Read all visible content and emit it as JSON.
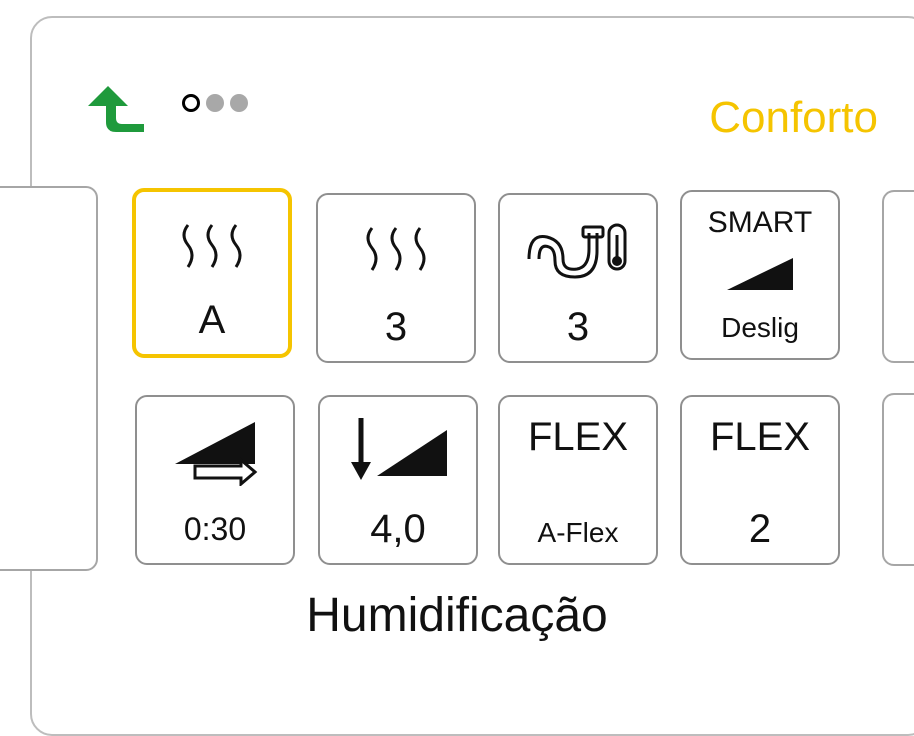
{
  "header": {
    "title": "Conforto",
    "back_icon": "back-arrow-icon",
    "page_dots": [
      "active",
      "inactive",
      "inactive"
    ]
  },
  "tiles": [
    {
      "icon": "humidifier-waves-icon",
      "value": "A"
    },
    {
      "icon": "humidifier-waves-icon",
      "value": "3"
    },
    {
      "icon": "heated-tube-icon",
      "value": "3"
    },
    {
      "top": "SMART",
      "icon": "ramp-triangle-icon",
      "value": "Deslig"
    },
    {
      "icon": "ramp-time-icon",
      "value": "0:30"
    },
    {
      "icon": "ramp-start-pressure-icon",
      "value": "4,0"
    },
    {
      "top": "FLEX",
      "value": "A-Flex"
    },
    {
      "top": "FLEX",
      "value": "2"
    }
  ],
  "selected_label": "Humidificação",
  "colors": {
    "accent": "#f5c400",
    "back_arrow": "#1f9a3c",
    "border": "#8f8f8f"
  }
}
